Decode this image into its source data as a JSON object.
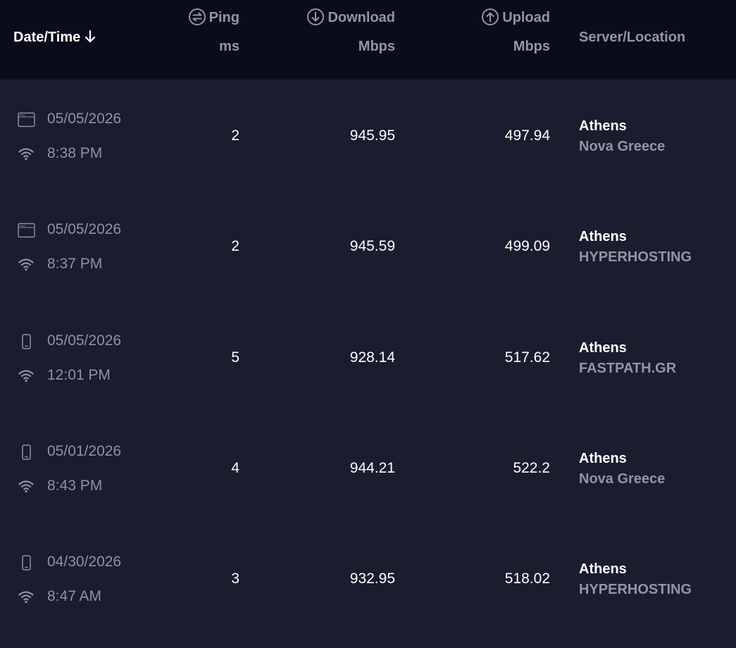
{
  "header": {
    "date_time": "Date/Time",
    "ping_label": "Ping",
    "ping_unit": "ms",
    "download_label": "Download",
    "download_unit": "Mbps",
    "upload_label": "Upload",
    "upload_unit": "Mbps",
    "server_location": "Server/Location"
  },
  "colors": {
    "header_bg": "#0b0c1b",
    "body_bg": "#1b1c2e",
    "muted_text": "#9294a8",
    "primary_text": "#ffffff"
  },
  "rows": [
    {
      "device_icon": "desktop-app-icon",
      "connection_icon": "wifi-icon",
      "date": "05/05/2026",
      "time": "8:38 PM",
      "ping": "2",
      "download": "945.95",
      "upload": "497.94",
      "city": "Athens",
      "provider": "Nova Greece"
    },
    {
      "device_icon": "desktop-app-icon",
      "connection_icon": "wifi-icon",
      "date": "05/05/2026",
      "time": "8:37 PM",
      "ping": "2",
      "download": "945.59",
      "upload": "499.09",
      "city": "Athens",
      "provider": "HYPERHOSTING"
    },
    {
      "device_icon": "mobile-phone-icon",
      "connection_icon": "wifi-icon",
      "date": "05/05/2026",
      "time": "12:01 PM",
      "ping": "5",
      "download": "928.14",
      "upload": "517.62",
      "city": "Athens",
      "provider": "FASTPATH.GR"
    },
    {
      "device_icon": "mobile-phone-icon",
      "connection_icon": "wifi-icon",
      "date": "05/01/2026",
      "time": "8:43 PM",
      "ping": "4",
      "download": "944.21",
      "upload": "522.2",
      "city": "Athens",
      "provider": "Nova Greece"
    },
    {
      "device_icon": "mobile-phone-icon",
      "connection_icon": "wifi-icon",
      "date": "04/30/2026",
      "time": "8:47 AM",
      "ping": "3",
      "download": "932.95",
      "upload": "518.02",
      "city": "Athens",
      "provider": "HYPERHOSTING"
    }
  ]
}
